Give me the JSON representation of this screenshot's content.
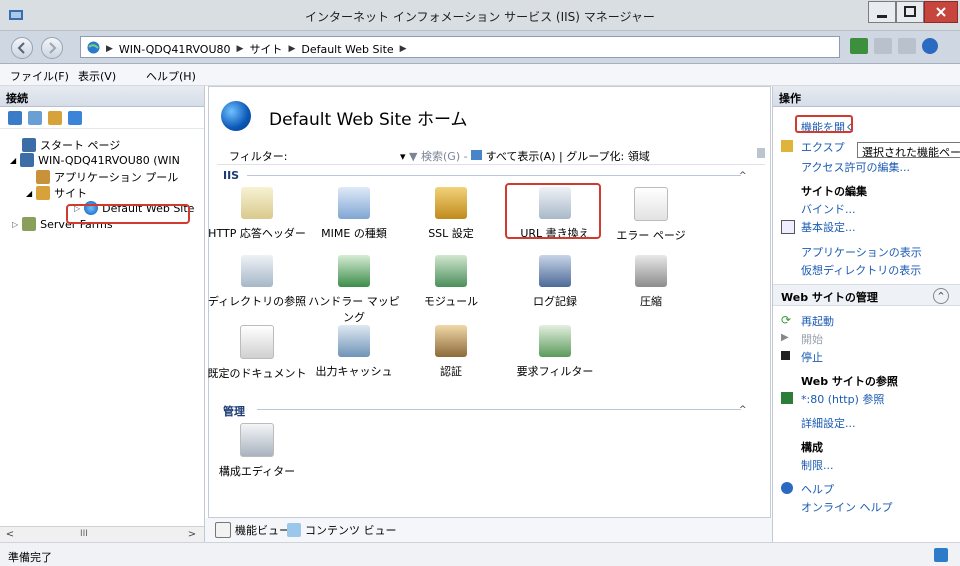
{
  "window": {
    "title": "インターネット インフォメーション サービス (IIS) マネージャー",
    "min_label": "−",
    "max_label": "□",
    "close_label": "x"
  },
  "address": {
    "crumbs": [
      "WIN-QDQ41RVOU80",
      "サイト",
      "Default Web Site"
    ]
  },
  "menu": {
    "file": "ファイル(F)",
    "view": "表示(V)",
    "help": "ヘルプ(H)"
  },
  "connections": {
    "header": "接続",
    "tree": [
      {
        "label": "スタート ページ"
      },
      {
        "label": "WIN-QDQ41RVOU80 (WIN"
      },
      {
        "label": "アプリケーション プール"
      },
      {
        "label": "サイト"
      },
      {
        "label": "Default Web Site"
      },
      {
        "label": "Server Farms"
      }
    ],
    "scroll_mid": "III"
  },
  "main": {
    "home_title": "Default Web Site ホーム",
    "filter_label": "フィルター:",
    "search_label": "検索(G)",
    "show_all_label": "すべて表示(A)",
    "group_label": "| グループ化:",
    "group_value": "領域",
    "groups": [
      {
        "name": "IIS"
      },
      {
        "name": "管理"
      }
    ],
    "features": [
      {
        "label": "HTTP 応答ヘッダー",
        "icon": "http-headers-icon"
      },
      {
        "label": "MIME の種類",
        "icon": "mime-types-icon"
      },
      {
        "label": "SSL 設定",
        "icon": "ssl-lock-icon"
      },
      {
        "label": "URL 書き換え",
        "icon": "url-rewrite-icon"
      },
      {
        "label": "エラー ページ",
        "icon": "error-pages-icon"
      },
      {
        "label": "ディレクトリの参照",
        "icon": "directory-browsing-icon"
      },
      {
        "label": "ハンドラー マッピング",
        "icon": "handler-mappings-icon"
      },
      {
        "label": "モジュール",
        "icon": "modules-icon"
      },
      {
        "label": "ログ記録",
        "icon": "logging-icon"
      },
      {
        "label": "圧縮",
        "icon": "compression-icon"
      },
      {
        "label": "既定のドキュメント",
        "icon": "default-document-icon"
      },
      {
        "label": "出力キャッシュ",
        "icon": "output-cache-icon"
      },
      {
        "label": "認証",
        "icon": "authentication-icon"
      },
      {
        "label": "要求フィルター",
        "icon": "request-filtering-icon"
      },
      {
        "label": "構成エディター",
        "icon": "configuration-editor-icon"
      }
    ],
    "tabs": {
      "features_view": "機能ビュー",
      "content_view": "コンテンツ ビュー"
    }
  },
  "actions": {
    "header": "操作",
    "open_feature": "機能を開く",
    "explore": "エクスプ",
    "tooltip": "選択された機能ページを開き",
    "edit_permissions": "アクセス許可の編集...",
    "edit_site_head": "サイトの編集",
    "bindings": "バインド...",
    "basic_settings": "基本設定...",
    "view_applications": "アプリケーションの表示",
    "view_virtual_dirs": "仮想ディレクトリの表示",
    "manage_site_head": "Web サイトの管理",
    "restart": "再起動",
    "start": "開始",
    "stop": "停止",
    "browse_head": "Web サイトの参照",
    "browse_80": "*:80 (http) 参照",
    "advanced_settings": "詳細設定...",
    "config_head": "構成",
    "limits": "制限...",
    "help": "ヘルプ",
    "online_help": "オンライン ヘルプ"
  },
  "status": {
    "text": "準備完了"
  },
  "colors": {
    "highlight": "#d13b2f",
    "link": "#1b5bb3",
    "group_heading": "#1c3b73"
  }
}
